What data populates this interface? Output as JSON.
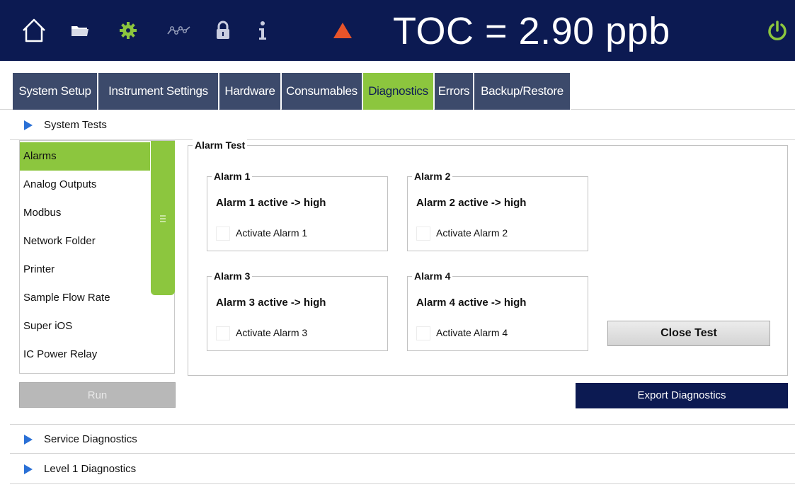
{
  "header": {
    "reading": "TOC = 2.90 ppb",
    "icons": [
      "home-icon",
      "folder-icon",
      "gear-icon",
      "trend-icon",
      "lock-icon",
      "info-icon",
      "warning-icon",
      "power-icon"
    ],
    "colors": {
      "background": "#0c1a52",
      "gear": "#8cc63e",
      "warning": "#e8542a",
      "power": "#8cc63e"
    }
  },
  "tabs": [
    {
      "label": "System Setup",
      "active": false
    },
    {
      "label": "Instrument Settings",
      "active": false
    },
    {
      "label": "Hardware",
      "active": false
    },
    {
      "label": "Consumables",
      "active": false
    },
    {
      "label": "Diagnostics",
      "active": true
    },
    {
      "label": "Errors",
      "active": false
    },
    {
      "label": "Backup/Restore",
      "active": false
    }
  ],
  "sections": {
    "system_tests": "System Tests",
    "service_diagnostics": "Service Diagnostics",
    "level1_diagnostics": "Level 1 Diagnostics"
  },
  "test_list": {
    "items": [
      "Alarms",
      "Analog Outputs",
      "Modbus",
      "Network Folder",
      "Printer",
      "Sample Flow Rate",
      "Super iOS",
      "IC Power Relay"
    ],
    "selected": "Alarms"
  },
  "run_label": "Run",
  "alarm_test": {
    "title": "Alarm Test",
    "alarms": [
      {
        "title": "Alarm 1",
        "state": "Alarm 1 active -> high",
        "checkbox_label": "Activate Alarm 1",
        "checked": false
      },
      {
        "title": "Alarm 2",
        "state": "Alarm 2 active -> high",
        "checkbox_label": "Activate Alarm 2",
        "checked": false
      },
      {
        "title": "Alarm 3",
        "state": "Alarm 3 active -> high",
        "checkbox_label": "Activate Alarm 3",
        "checked": false
      },
      {
        "title": "Alarm 4",
        "state": "Alarm 4 active -> high",
        "checkbox_label": "Activate Alarm 4",
        "checked": false
      }
    ],
    "close_label": "Close Test"
  },
  "export_label": "Export Diagnostics",
  "accent_colors": {
    "green": "#8cc63e",
    "navy": "#0c1a52",
    "tab": "#3c4a6b",
    "triangle": "#2a70d6"
  }
}
